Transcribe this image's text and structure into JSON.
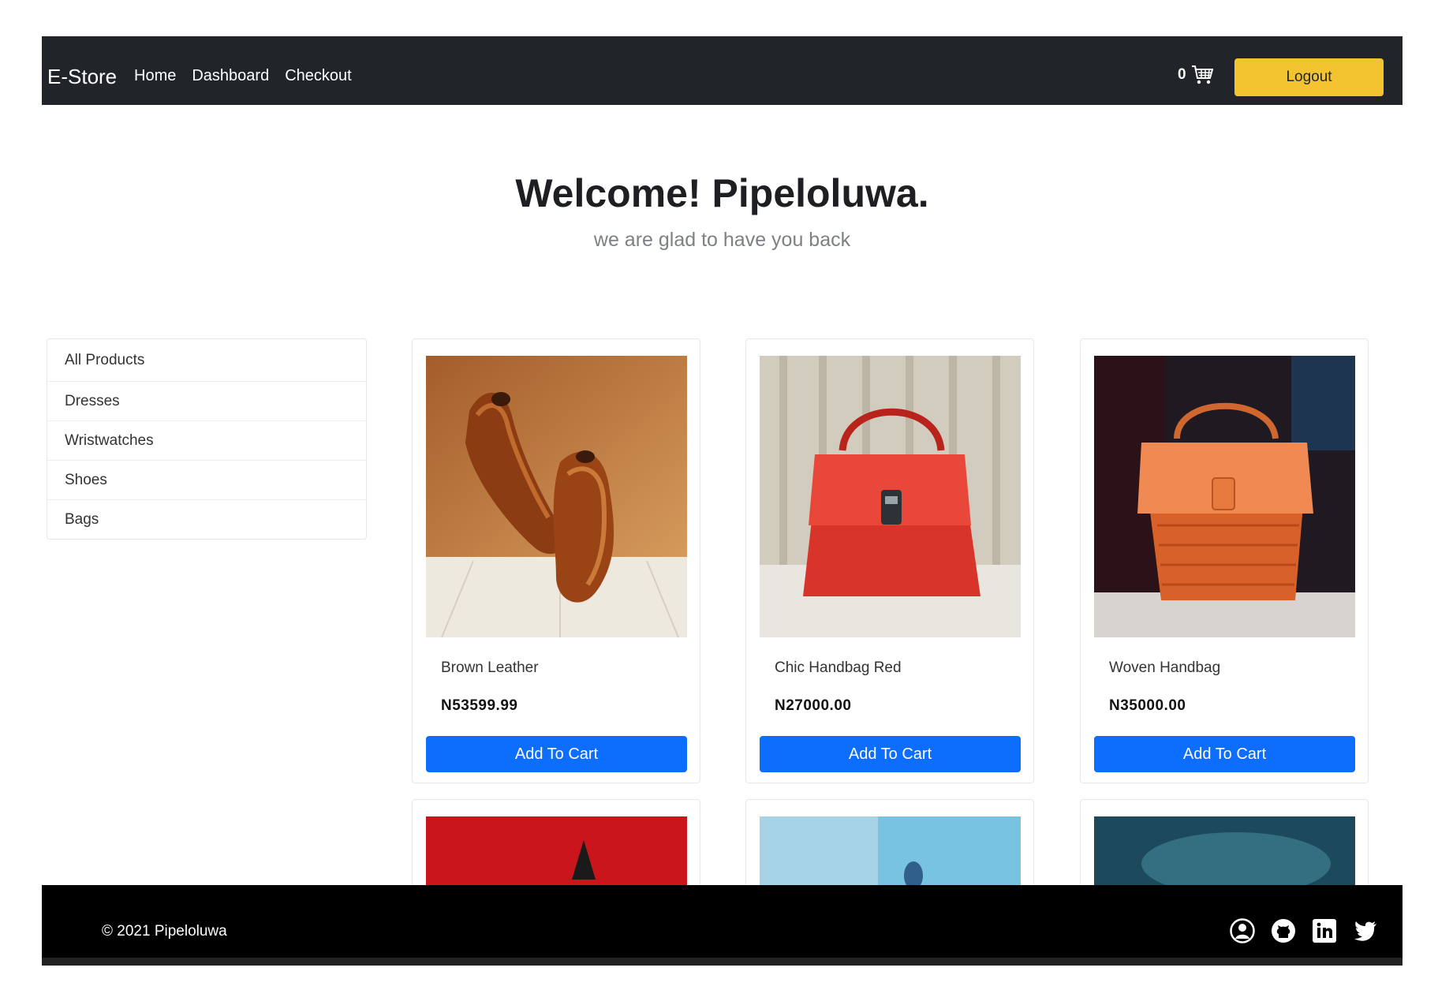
{
  "navbar": {
    "brand": "E-Store",
    "links": [
      "Home",
      "Dashboard",
      "Checkout"
    ],
    "cart_count": "0",
    "logout_label": "Logout"
  },
  "hero": {
    "title": "Welcome! Pipeloluwa.",
    "subtitle": "we are glad to have you back"
  },
  "sidebar": {
    "items": [
      "All Products",
      "Dresses",
      "Wristwatches",
      "Shoes",
      "Bags"
    ]
  },
  "products": [
    {
      "name": "Brown Leather",
      "price": "N53599.99",
      "button": "Add To Cart",
      "image": "brown-leather-shoes"
    },
    {
      "name": "Chic Handbag Red",
      "price": "N27000.00",
      "button": "Add To Cart",
      "image": "red-handbag"
    },
    {
      "name": "Woven Handbag",
      "price": "N35000.00",
      "button": "Add To Cart",
      "image": "woven-orange-handbag"
    }
  ],
  "footer": {
    "copyright": "© 2021 Pipeloluwa",
    "icons": [
      "user-circle-icon",
      "github-icon",
      "linkedin-icon",
      "twitter-icon"
    ]
  },
  "colors": {
    "navbar_bg": "#212529",
    "logout_bg": "#f4c430",
    "button_primary": "#0d6efd",
    "footer_bg": "#000000"
  }
}
